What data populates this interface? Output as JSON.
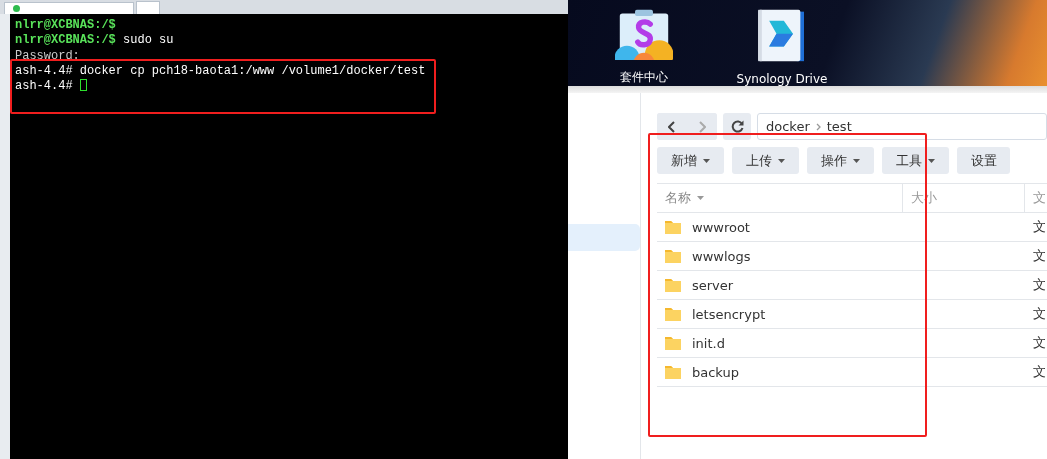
{
  "terminal": {
    "lines": [
      {
        "kind": "user",
        "prompt": "nlrr@XCBNAS:/$"
      },
      {
        "kind": "user",
        "prompt": "nlrr@XCBNAS:/$",
        "command": "sudo su"
      },
      {
        "kind": "output",
        "text": "Password:"
      },
      {
        "kind": "root",
        "prompt": "ash-4.4#",
        "command": "docker cp pch18-baota1:/www /volume1/docker/test"
      },
      {
        "kind": "root",
        "prompt": "ash-4.4#",
        "cursor": true
      }
    ]
  },
  "desktop": {
    "icons": [
      {
        "kind": "store",
        "label": "套件中心"
      },
      {
        "kind": "drive",
        "label": "Synology Drive"
      }
    ]
  },
  "file_station": {
    "path": [
      "docker",
      "test"
    ],
    "toolbar": [
      {
        "label": "新增",
        "dropdown": true
      },
      {
        "label": "上传",
        "dropdown": true
      },
      {
        "label": "操作",
        "dropdown": true
      },
      {
        "label": "工具",
        "dropdown": true
      },
      {
        "label": "设置",
        "dropdown": false
      }
    ],
    "columns": [
      {
        "label": "名称",
        "sorted": true
      },
      {
        "label": "大小",
        "sorted": false
      },
      {
        "label": "文",
        "sorted": false
      }
    ],
    "rows": [
      {
        "name": "wwwroot",
        "type": "文"
      },
      {
        "name": "wwwlogs",
        "type": "文"
      },
      {
        "name": "server",
        "type": "文"
      },
      {
        "name": "letsencrypt",
        "type": "文"
      },
      {
        "name": "init.d",
        "type": "文"
      },
      {
        "name": "backup",
        "type": "文"
      }
    ]
  }
}
